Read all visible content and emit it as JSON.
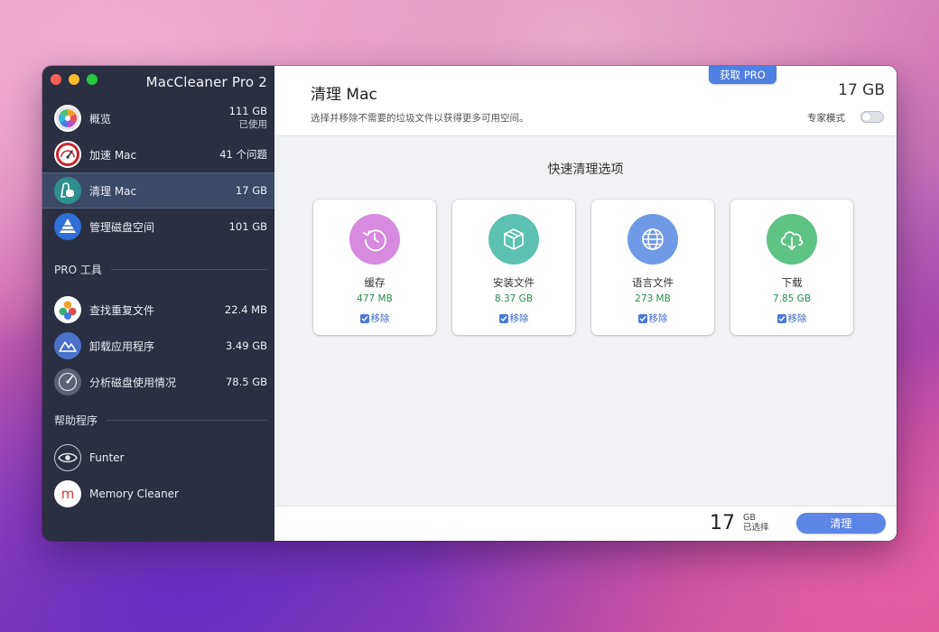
{
  "app": {
    "title": "MacCleaner Pro 2"
  },
  "sidebar": {
    "items": [
      {
        "label": "概览",
        "value": "111 GB",
        "sub": "已使用",
        "icon": "overview-icon"
      },
      {
        "label": "加速 Mac",
        "value": "41 个问题",
        "icon": "speedometer-icon"
      },
      {
        "label": "清理 Mac",
        "value": "17 GB",
        "icon": "vacuum-icon",
        "active": true
      },
      {
        "label": "管理磁盘空间",
        "value": "101 GB",
        "icon": "pyramid-icon"
      }
    ],
    "pro_section": "PRO 工具",
    "pro_items": [
      {
        "label": "查找重复文件",
        "value": "22.4 MB",
        "icon": "duplicates-icon"
      },
      {
        "label": "卸载应用程序",
        "value": "3.49 GB",
        "icon": "uninstall-icon"
      },
      {
        "label": "分析磁盘使用情况",
        "value": "78.5 GB",
        "icon": "disk-gauge-icon"
      }
    ],
    "helper_section": "帮助程序",
    "helper_items": [
      {
        "label": "Funter",
        "icon": "eye-icon"
      },
      {
        "label": "Memory Cleaner",
        "icon": "memory-cleaner-icon"
      }
    ]
  },
  "header": {
    "title": "清理 Mac",
    "subtitle": "选择并移除不需要的垃圾文件以获得更多可用空间。",
    "total": "17 GB",
    "pro_button": "获取 PRO",
    "expert_mode": "专家模式"
  },
  "main": {
    "section_title": "快速清理选项",
    "cards": [
      {
        "name": "缓存",
        "size": "477 MB",
        "action": "移除",
        "icon": "clock-icon",
        "color": "#d889e0"
      },
      {
        "name": "安装文件",
        "size": "8.37 GB",
        "action": "移除",
        "icon": "package-icon",
        "color": "#5cc1b0"
      },
      {
        "name": "语言文件",
        "size": "273 MB",
        "action": "移除",
        "icon": "globe-icon",
        "color": "#6f9be6"
      },
      {
        "name": "下载",
        "size": "7.85 GB",
        "action": "移除",
        "icon": "cloud-download-icon",
        "color": "#5fc386"
      }
    ]
  },
  "footer": {
    "selected_value": "17",
    "selected_unit": "GB",
    "selected_label": "已选择",
    "clean_button": "清理"
  }
}
